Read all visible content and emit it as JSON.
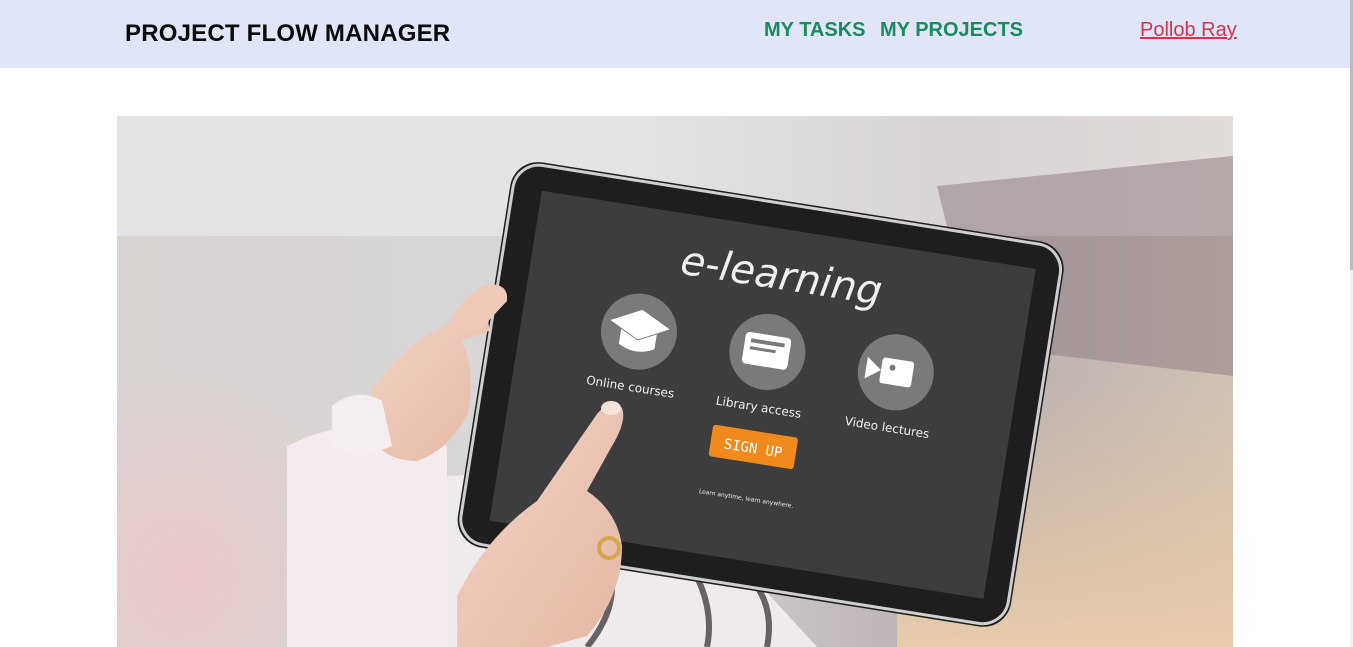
{
  "header": {
    "brand": "PROJECT FLOW MANAGER",
    "nav": [
      "MY TASKS",
      "MY PROJECTS"
    ],
    "user": "Pollob Ray"
  },
  "hero": {
    "tablet_title": "e-learning",
    "features": [
      "Online courses",
      "Library access",
      "Video lectures"
    ],
    "cta": "SIGN UP",
    "tagline": "Learn anytime, learn anywhere."
  },
  "colors": {
    "nav_bg": "#e0e6f8",
    "nav_link": "#188a5e",
    "user_link": "#d2344f",
    "cta": "#f08a1c"
  }
}
